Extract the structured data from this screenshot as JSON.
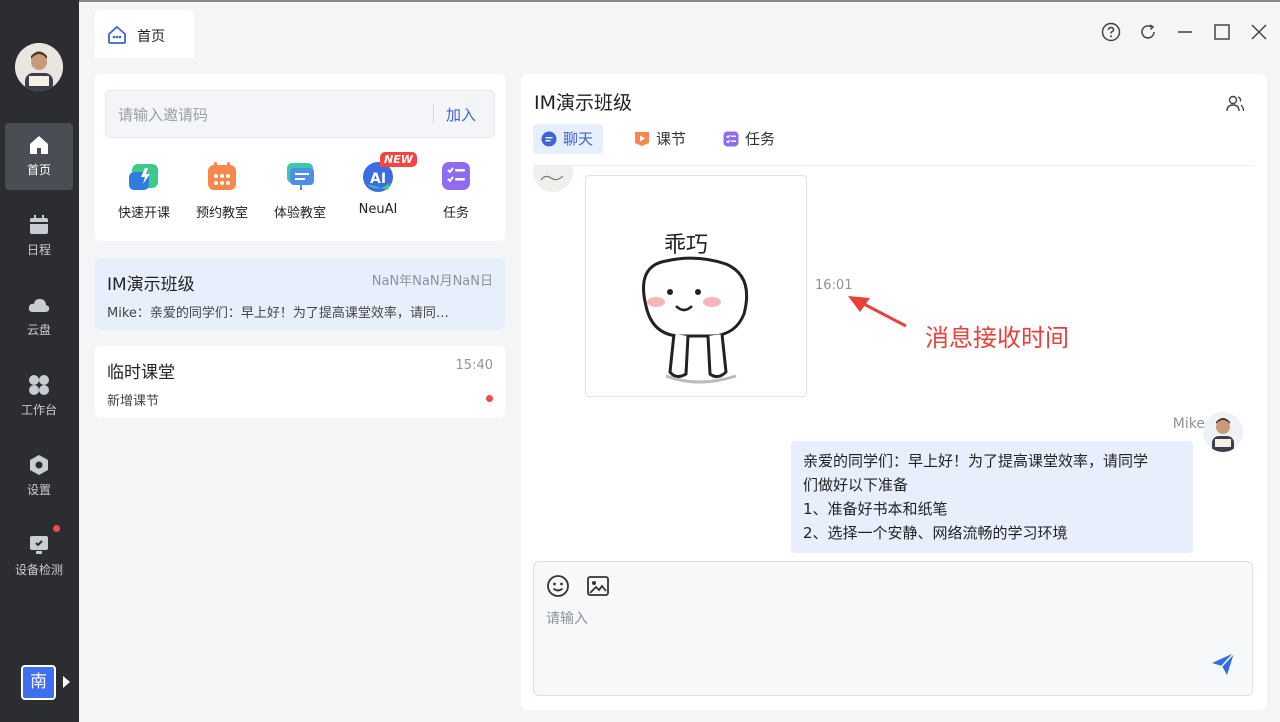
{
  "rail": {
    "items": [
      {
        "label": "首页",
        "icon": "home-icon"
      },
      {
        "label": "日程",
        "icon": "calendar-icon"
      },
      {
        "label": "云盘",
        "icon": "cloud-icon"
      },
      {
        "label": "工作台",
        "icon": "workbench-icon"
      },
      {
        "label": "设置",
        "icon": "settings-icon"
      },
      {
        "label": "设备检测",
        "icon": "device-check-icon"
      }
    ],
    "lang_label": "南"
  },
  "topbar": {
    "home_tab": "首页"
  },
  "invite": {
    "placeholder": "请输入邀请码",
    "join_label": "加入"
  },
  "quick_actions": [
    {
      "label": "快速开课",
      "icon": "quick-class-icon"
    },
    {
      "label": "预约教室",
      "icon": "reserve-classroom-icon"
    },
    {
      "label": "体验教室",
      "icon": "trial-classroom-icon"
    },
    {
      "label": "NeuAI",
      "icon": "neuai-icon",
      "badge": "NEW"
    },
    {
      "label": "任务",
      "icon": "task-icon"
    }
  ],
  "conversations": [
    {
      "title": "IM演示班级",
      "time": "NaN年NaN月NaN日",
      "preview": "Mike：亲爱的同学们：早上好！为了提高课堂效率，请同…"
    },
    {
      "title": "临时课堂",
      "time": "15:40",
      "preview": "新增课节"
    }
  ],
  "chat": {
    "title": "IM演示班级",
    "tabs": [
      {
        "label": "聊天",
        "icon": "chat-icon"
      },
      {
        "label": "课节",
        "icon": "lesson-icon"
      },
      {
        "label": "任务",
        "icon": "task-icon"
      }
    ],
    "sticker_text": "乖巧",
    "sticker_time": "16:01",
    "sender": "Mike",
    "message_lines": [
      "亲爱的同学们：早上好！为了提高课堂效率，请同学",
      "们做好以下准备",
      "1、准备好书本和纸笔",
      "2、选择一个安静、网络流畅的学习环境"
    ],
    "input_placeholder": "请输入"
  },
  "annotation": {
    "text": "消息接收时间"
  },
  "colors": {
    "accent": "#3f64d8",
    "rail": "#2b2d31",
    "annotation": "#e8413b",
    "badge": "#f2463f"
  }
}
